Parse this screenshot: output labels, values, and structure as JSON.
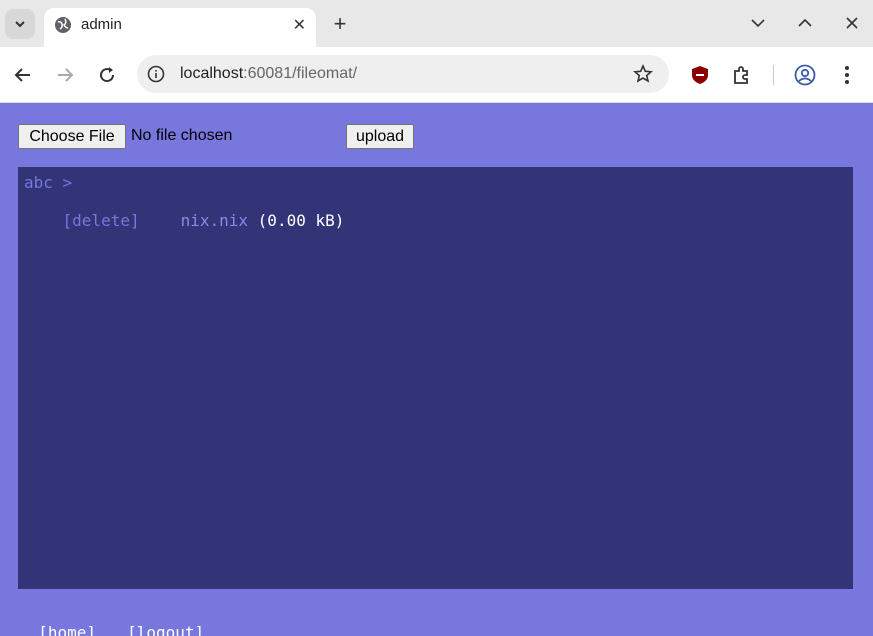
{
  "browser": {
    "tab_title": "admin",
    "url_host": "localhost",
    "url_rest": ":60081/fileomat/",
    "icons": [
      "tab-search-icon",
      "globe-icon",
      "close-icon",
      "plus-icon",
      "minimize-icon",
      "restore-icon",
      "close-window-icon",
      "back-icon",
      "forward-icon",
      "reload-icon",
      "info-icon",
      "star-icon",
      "shield-extension-icon",
      "puzzle-icon",
      "profile-icon",
      "menu-icon"
    ]
  },
  "upload": {
    "choose_label": "Choose File",
    "status": "No file chosen",
    "upload_label": "upload"
  },
  "listing": {
    "breadcrumb": "abc >",
    "files": [
      {
        "delete_label": "[delete]",
        "name": "nix.nix",
        "size": "(0.00 kB)"
      }
    ]
  },
  "footer": {
    "home": "[home]",
    "logout": "[logout]"
  },
  "colors": {
    "page_bg": "#7777dd",
    "panel_bg": "#333377",
    "link": "#7777dd"
  }
}
